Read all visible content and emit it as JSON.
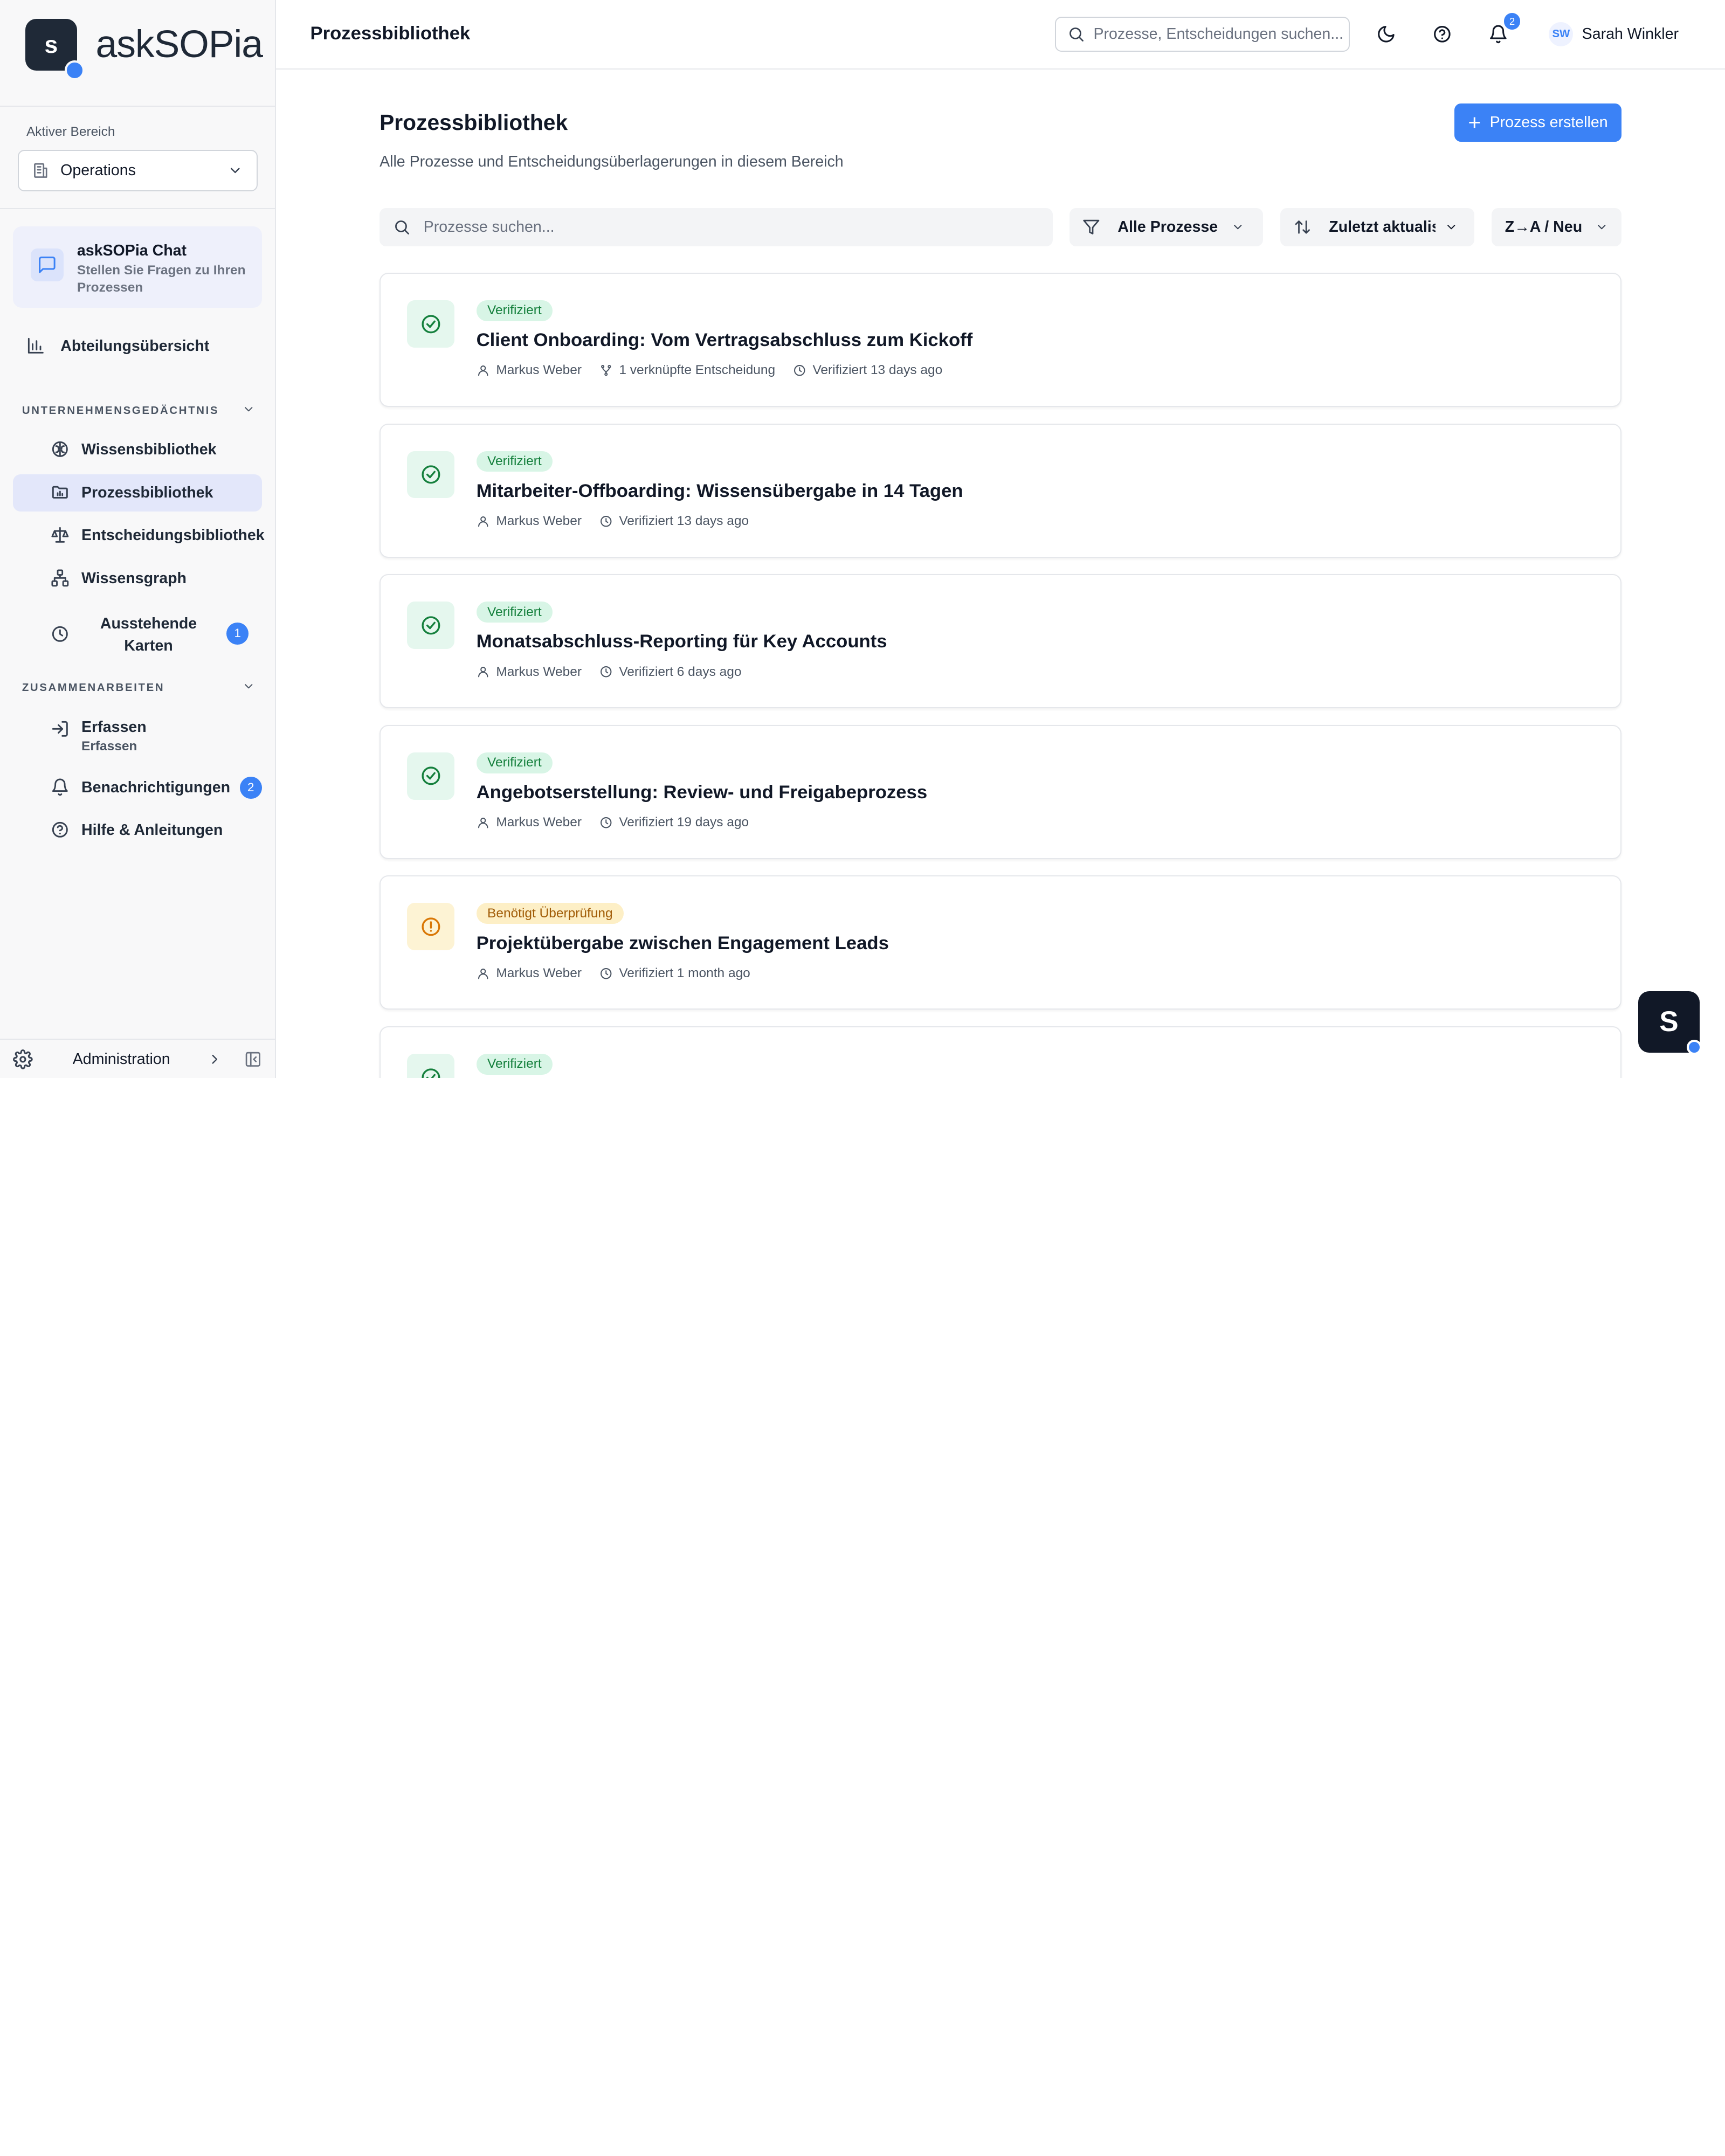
{
  "brand": {
    "logo_letter": "s",
    "name_light": "ask",
    "name_bold": "SOPia"
  },
  "sidebar": {
    "area_label": "Aktiver Bereich",
    "area_value": "Operations",
    "chat": {
      "title": "askSOPia Chat",
      "subtitle": "Stellen Sie Fragen zu Ihren Prozessen"
    },
    "overview_label": "Abteilungsübersicht",
    "section1": "UNTERNEHMENSGEDÄCHTNIS",
    "items1": [
      {
        "label": "Wissensbibliothek",
        "icon": "brain-icon"
      },
      {
        "label": "Prozessbibliothek",
        "icon": "folder-chart-icon"
      },
      {
        "label": "Entscheidungsbibliothek",
        "icon": "scale-icon"
      },
      {
        "label": "Wissensgraph",
        "icon": "network-icon"
      },
      {
        "label": "Ausstehende Karten",
        "icon": "clock-icon",
        "badge": "1"
      }
    ],
    "section2": "ZUSAMMENARBEITEN",
    "items2": [
      {
        "label": "Erfassen",
        "sublabel": "Erfassen",
        "icon": "login-icon"
      },
      {
        "label": "Benachrichtigungen",
        "icon": "bell-icon",
        "badge": "2"
      },
      {
        "label": "Hilfe & Anleitungen",
        "icon": "help-icon"
      }
    ],
    "footer_label": "Administration"
  },
  "topbar": {
    "title": "Prozessbibliothek",
    "search_placeholder": "Prozesse, Entscheidungen suchen...",
    "notif_count": "2",
    "user_initials": "SW",
    "user_name": "Sarah Winkler"
  },
  "main": {
    "heading": "Prozessbibliothek",
    "subtitle": "Alle Prozesse und Entscheidungsüberlagerungen in diesem Bereich",
    "create_label": "Prozess erstellen",
    "search_placeholder": "Prozesse suchen...",
    "filter_label": "Alle Prozesse",
    "sort_label": "Zuletzt aktualis",
    "order_label": "Z→A / Neu"
  },
  "cards": [
    {
      "status": "Verifiziert",
      "kind": "ok",
      "title": "Client Onboarding: Vom Vertragsabschluss zum Kickoff",
      "author": "Markus Weber",
      "links": "1 verknüpfte Entscheidung",
      "verified": "Verifiziert 13 days ago"
    },
    {
      "status": "Verifiziert",
      "kind": "ok",
      "title": "Mitarbeiter-Offboarding: Wissensübergabe in 14 Tagen",
      "author": "Markus Weber",
      "verified": "Verifiziert 13 days ago"
    },
    {
      "status": "Verifiziert",
      "kind": "ok",
      "title": "Monatsabschluss-Reporting für Key Accounts",
      "author": "Markus Weber",
      "verified": "Verifiziert 6 days ago"
    },
    {
      "status": "Verifiziert",
      "kind": "ok",
      "title": "Angebotserstellung: Review- und Freigabeprozess",
      "author": "Markus Weber",
      "verified": "Verifiziert 19 days ago"
    },
    {
      "status": "Benötigt Überprüfung",
      "kind": "warn",
      "title": "Projektübergabe zwischen Engagement Leads",
      "author": "Markus Weber",
      "verified": "Verifiziert 1 month ago"
    },
    {
      "status": "Verifiziert",
      "kind": "ok"
    }
  ],
  "fab_letter": "S",
  "colors": {
    "accent": "#3b82f6",
    "verified_bg": "#d8f5e6",
    "verified_text": "#15803d",
    "warn_bg": "#fdefc6",
    "warn_text": "#a15c07",
    "active_nav": "#e3e7fa"
  }
}
